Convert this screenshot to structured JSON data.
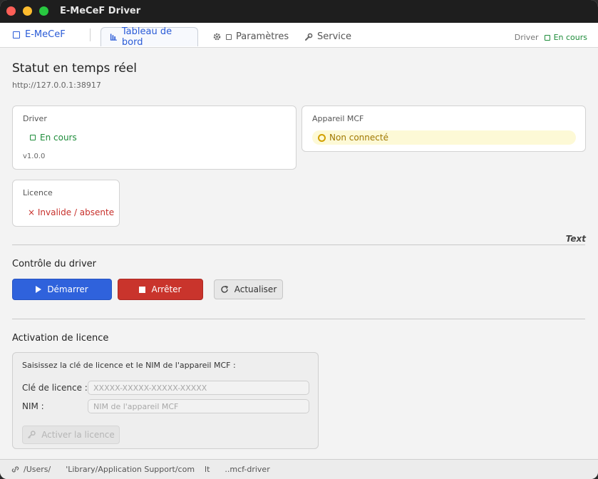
{
  "window": {
    "title": "E-MeCeF Driver"
  },
  "navbar": {
    "brand": "E-MeCeF",
    "tabs": [
      {
        "label": "Tableau de bord",
        "icon": "bar-chart-icon",
        "active": true
      },
      {
        "label": "Paramètres",
        "icon": "gear-icon",
        "active": false
      },
      {
        "label": "Service",
        "icon": "wrench-icon",
        "active": false
      }
    ],
    "status_label": "Driver",
    "status_value": "En cours"
  },
  "dashboard": {
    "title": "Statut en temps réel",
    "url": "http://127.0.0.1:38917",
    "driver_card": {
      "title": "Driver",
      "status": "En cours",
      "version": "v1.0.0"
    },
    "mcf_card": {
      "title": "Appareil MCF",
      "status": "Non connecté"
    },
    "licence_card": {
      "title": "Licence",
      "status": "× Invalide / absente"
    },
    "separator_text": "Text"
  },
  "control": {
    "title": "Contrôle du driver",
    "start_label": "Démarrer",
    "stop_label": "Arrêter",
    "refresh_label": "Actualiser"
  },
  "activation": {
    "title": "Activation de licence",
    "intro": "Saisissez la clé de licence et le NIM de l'appareil MCF :",
    "key_label": "Clé de licence :",
    "key_placeholder": "XXXXX-XXXXX-XXXXX-XXXXX",
    "nim_label": "NIM :",
    "nim_placeholder": "NIM de l'appareil MCF",
    "activate_label": "Activer la licence"
  },
  "statusbar": {
    "path": "/Users/      'Library/Application Support/com    lt      ..mcf-driver"
  },
  "colors": {
    "accent": "#2f62dc",
    "danger": "#c9342c",
    "success": "#1e8c3a",
    "warning": "#d2a000"
  }
}
